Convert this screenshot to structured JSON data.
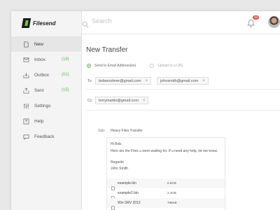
{
  "app": {
    "logo_text": "Filesend"
  },
  "sidebar": {
    "items": [
      {
        "label": "New",
        "count": ""
      },
      {
        "label": "Inbox",
        "count": "(18)"
      },
      {
        "label": "Outbox",
        "count": "(01)"
      },
      {
        "label": "Sent",
        "count": "(15)"
      },
      {
        "label": "Settings",
        "count": ""
      },
      {
        "label": "Help",
        "count": ""
      },
      {
        "label": "Feedback",
        "count": ""
      }
    ]
  },
  "topbar": {
    "search_placeholder": "Search",
    "notification_count": "10"
  },
  "compose": {
    "title": "New Transfer",
    "option_email": "Send to Email Address(es)",
    "option_url": "Upload to a URL",
    "to_label": "To",
    "to_recipients": [
      "bobwoolmer@gmail.com",
      "johnsmith@gmail.com"
    ],
    "cc_label": "Cc",
    "cc_recipients": [
      "terrymartin@gmail.com"
    ],
    "remove_glyph": "×",
    "subject_label": "Sub:",
    "subject_value": "Heavy Files Transfer",
    "body_lines": [
      "Hi Bob,",
      "Here are the Files u were waiting for. If u need any help, let me know.",
      "Regards",
      "John Smith"
    ],
    "attachments": [
      {
        "name": "example.bin",
        "size": "6.5GB"
      },
      {
        "name": "example2.bin",
        "size": "2.4GB"
      },
      {
        "name": "Win SRV 2012",
        "size": "786KB"
      }
    ]
  },
  "colors": {
    "accent": "#5cb85c",
    "badge": "#e9505a",
    "logo_green": "#7cc242"
  }
}
